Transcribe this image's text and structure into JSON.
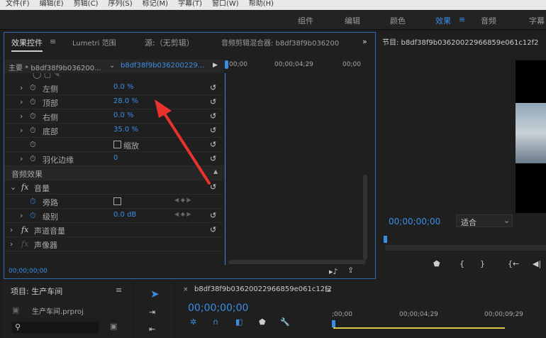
{
  "menu": [
    "文件(F)",
    "编辑(E)",
    "剪辑(C)",
    "序列(S)",
    "标记(M)",
    "字幕(T)",
    "窗口(W)",
    "帮助(H)"
  ],
  "workspaces": [
    "组件",
    "编辑",
    "颜色",
    "效果",
    "≡",
    "音频",
    "字幕"
  ],
  "effect_panel": {
    "tabs": [
      "效果控件",
      "≡",
      "Lumetri 范围",
      "源:（无剪辑）",
      "音频剪辑混合器: b8df38f9b036200",
      "»"
    ],
    "master_clip": "主要 * b8df38f9b036200...",
    "sequence_clip": "b8df38f9b036200229...",
    "ruler": [
      "00;00",
      "00;00;04;29",
      "00;00"
    ],
    "rows": [
      {
        "label": "左侧",
        "value": "0.0 %"
      },
      {
        "label": "顶部",
        "value": "28.0 %"
      },
      {
        "label": "右侧",
        "value": "0.0 %"
      },
      {
        "label": "底部",
        "value": "35.0 %"
      },
      {
        "label": "",
        "value": "缩放"
      },
      {
        "label": "羽化边缘",
        "value": "0"
      }
    ],
    "audio_section": "音频效果",
    "audio_rows": [
      {
        "label": "音量"
      },
      {
        "label": "旁路"
      },
      {
        "label": "级别",
        "value": "0.0 dB"
      },
      {
        "label": "声道音量"
      },
      {
        "label": "声像器"
      }
    ],
    "fx": "fx",
    "timecode": "00;00;00;00"
  },
  "program": {
    "title": "节目: b8df38f9b03620022966859e061c12f2",
    "timecode": "00;00;00;00",
    "fit": "适合"
  },
  "project": {
    "title": "项目: 生产车间",
    "file": "生产车间.prproj"
  },
  "timeline": {
    "title": "b8df38f9b03620022966859e061c12f2",
    "timecode": "00;00;00;00",
    "ruler": [
      ";00;00",
      "00;00;04;29",
      "00;00;09;29"
    ]
  },
  "colors": {
    "accent": "#3a8ee6",
    "arrow": "#e8322e"
  }
}
